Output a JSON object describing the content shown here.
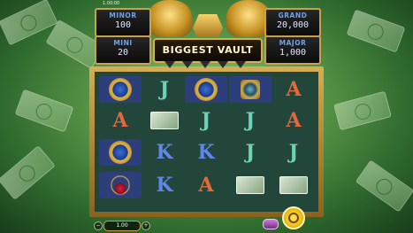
{
  "jackpots": {
    "minor": {
      "label": "MINOR",
      "value": "100"
    },
    "mini": {
      "label": "MINI",
      "value": "20"
    },
    "grand": {
      "label": "GRAND",
      "value": "20,000"
    },
    "major": {
      "label": "MAJOR",
      "value": "1,000"
    }
  },
  "vault_sign": "BIGGEST VAULT",
  "top_meta": "1.00:00",
  "reels": [
    [
      "watch",
      "A",
      "watch",
      "necklace",
      ""
    ],
    [
      "J",
      "cash",
      "K",
      "K",
      ""
    ],
    [
      "watch",
      "J",
      "K",
      "A",
      ""
    ],
    [
      "ring",
      "J",
      "J",
      "cash",
      ""
    ],
    [
      "A",
      "A",
      "J",
      "cash",
      ""
    ]
  ],
  "bet_display": "1.00",
  "colors": {
    "frame_gold": "#d3ad57",
    "reel_bg": "#23463a",
    "letter_J": "#6fd1b5",
    "letter_A": "#e2683d",
    "letter_K": "#5f86e8",
    "spin_button": "#f5c21b"
  },
  "icons": {
    "spin": "spin-button-icon",
    "autoplay": "autoplay-icon",
    "minus": "minus-icon",
    "plus": "plus-icon"
  }
}
